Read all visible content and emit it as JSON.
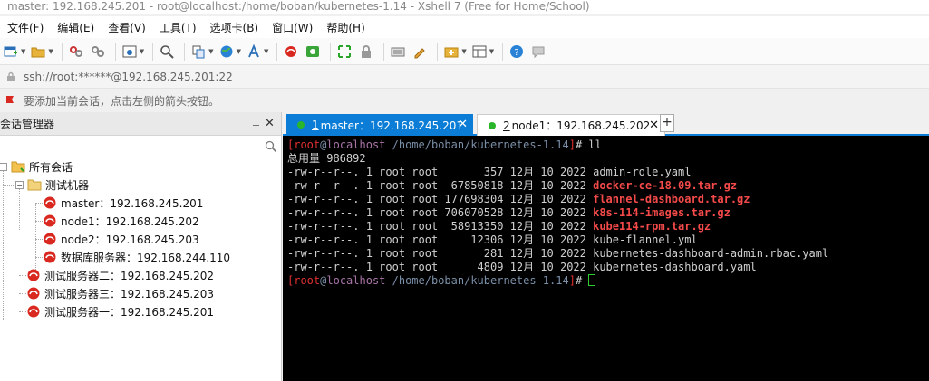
{
  "window": {
    "title": "master:  192.168.245.201 - root@localhost:/home/boban/kubernetes-1.14 - Xshell 7 (Free for Home/School)"
  },
  "menu": [
    "文件(F)",
    "编辑(E)",
    "查看(V)",
    "工具(T)",
    "选项卡(B)",
    "窗口(W)",
    "帮助(H)"
  ],
  "address": {
    "text": "ssh://root:******@192.168.245.201:22"
  },
  "hint": {
    "text": "要添加当前会话，点击左侧的箭头按钮。"
  },
  "sidebar": {
    "title": "会话管理器",
    "pin": "⊥",
    "close": "✕",
    "tree": {
      "root": "所有会话",
      "folder": "测试机器",
      "folder_children": [
        "master：192.168.245.201",
        "node1：192.168.245.202",
        "node2：192.168.245.203",
        "数据库服务器：192.168.244.110"
      ],
      "root_children": [
        "测试服务器二：192.168.245.202",
        "测试服务器三：192.168.245.203",
        "测试服务器一：192.168.245.201"
      ]
    }
  },
  "tabs": [
    {
      "num": "1",
      "label": "master：192.168.245.201",
      "close": "✕"
    },
    {
      "num": "2",
      "label": "node1：192.168.245.202",
      "close": "✕"
    }
  ],
  "tab_add": "+",
  "terminal": {
    "prompt1": {
      "lb": "[",
      "user": "root",
      "at": "@",
      "host": "localhost",
      "path": " /home/boban/kubernetes-1.14",
      "rb": "]",
      "hash": "# ",
      "cmd": "ll"
    },
    "total": "总用量 986892",
    "files": [
      {
        "meta": "-rw-r--r--. 1 root root       357 12月 10 2022 ",
        "name": "admin-role.yaml",
        "highlight": false
      },
      {
        "meta": "-rw-r--r--. 1 root root  67850818 12月 10 2022 ",
        "name": "docker-ce-18.09.tar.gz",
        "highlight": true
      },
      {
        "meta": "-rw-r--r--. 1 root root 177698304 12月 10 2022 ",
        "name": "flannel-dashboard.tar.gz",
        "highlight": true
      },
      {
        "meta": "-rw-r--r--. 1 root root 706070528 12月 10 2022 ",
        "name": "k8s-114-images.tar.gz",
        "highlight": true
      },
      {
        "meta": "-rw-r--r--. 1 root root  58913350 12月 10 2022 ",
        "name": "kube114-rpm.tar.gz",
        "highlight": true
      },
      {
        "meta": "-rw-r--r--. 1 root root     12306 12月 10 2022 ",
        "name": "kube-flannel.yml",
        "highlight": false
      },
      {
        "meta": "-rw-r--r--. 1 root root       281 12月 10 2022 ",
        "name": "kubernetes-dashboard-admin.rbac.yaml",
        "highlight": false
      },
      {
        "meta": "-rw-r--r--. 1 root root      4809 12月 10 2022 ",
        "name": "kubernetes-dashboard.yaml",
        "highlight": false
      }
    ],
    "prompt2": {
      "lb": "[",
      "user": "root",
      "at": "@",
      "host": "localhost",
      "path": " /home/boban/kubernetes-1.14",
      "rb": "]",
      "hash": "# "
    }
  },
  "colors": {
    "accent": "#0b7dd6",
    "terminal_bg": "#000000",
    "file_highlight": "#f44a4a",
    "session_dot": "#2bb52b"
  }
}
